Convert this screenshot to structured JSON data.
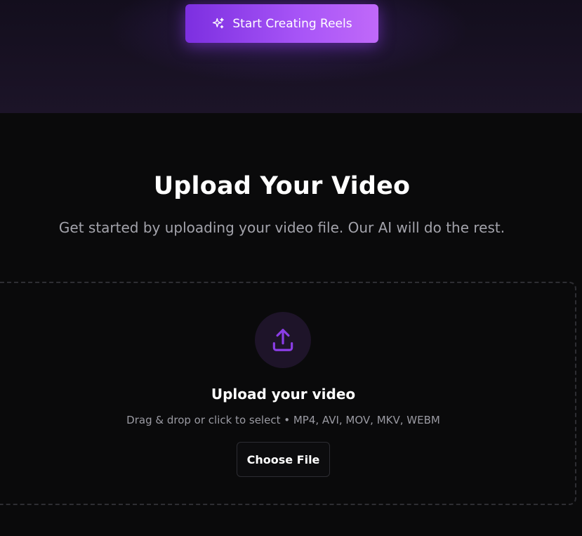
{
  "hero": {
    "cta_label": "Start Creating Reels",
    "cta_icon": "sparkles-icon",
    "cta_gradient": [
      "#7c2fe0",
      "#c069f9"
    ]
  },
  "upload_section": {
    "title": "Upload Your Video",
    "subtitle": "Get started by uploading your video file. Our AI will do the rest."
  },
  "dropzone": {
    "icon": "upload-icon",
    "icon_color": "#8b3de6",
    "title": "Upload your video",
    "hint": "Drag & drop or click to select • MP4, AVI, MOV, MKV, WEBM",
    "button_label": "Choose File"
  }
}
